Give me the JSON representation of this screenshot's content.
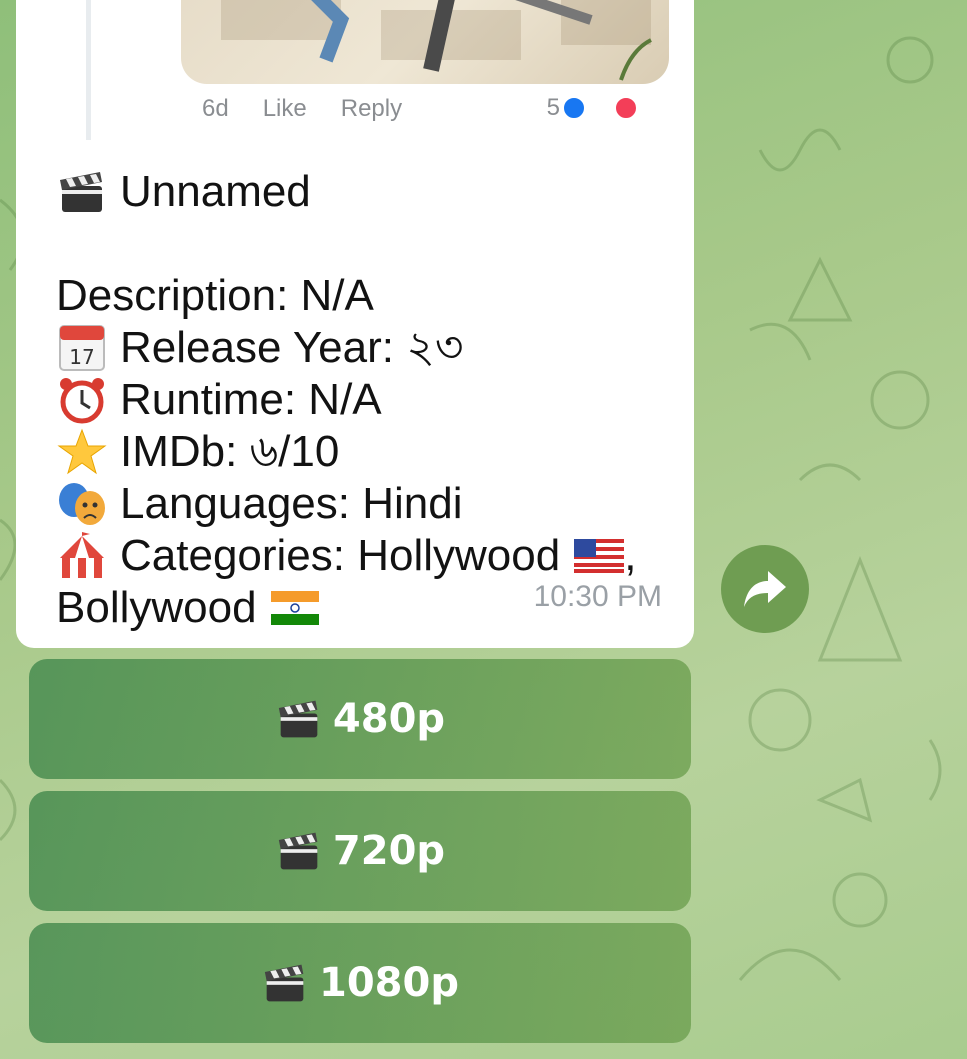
{
  "quoted_post": {
    "age": "6d",
    "like_label": "Like",
    "reply_label": "Reply",
    "reaction_count": "5"
  },
  "message": {
    "title_icon": "clapper-board-icon",
    "title": "Unnamed",
    "description": "Description: N/A",
    "release_icon": "calendar-icon",
    "release": "Release Year: ২৩",
    "runtime_icon": "alarm-clock-icon",
    "runtime": "Runtime: N/A",
    "imdb_icon": "star-icon",
    "imdb": "IMDb: ৬/10",
    "languages_icon": "theater-masks-icon",
    "languages": "Languages: Hindi",
    "categories_icon": "circus-tent-icon",
    "categories_line1": "Categories: Hollywood",
    "categories_sep": ",",
    "categories_line2": "Bollywood",
    "flags": [
      "us-flag-icon",
      "india-flag-icon"
    ],
    "time": "10:30 PM"
  },
  "forward_icon": "forward-arrow-icon",
  "keyboard": {
    "buttons": [
      {
        "icon": "clapper-board-icon",
        "label": "480p"
      },
      {
        "icon": "clapper-board-icon",
        "label": "720p"
      },
      {
        "icon": "clapper-board-icon",
        "label": "1080p"
      }
    ]
  },
  "colors": {
    "bubble": "#ffffff",
    "text": "#121212",
    "timestamp": "#9aa0a6",
    "button_green": "#6f9d52"
  }
}
